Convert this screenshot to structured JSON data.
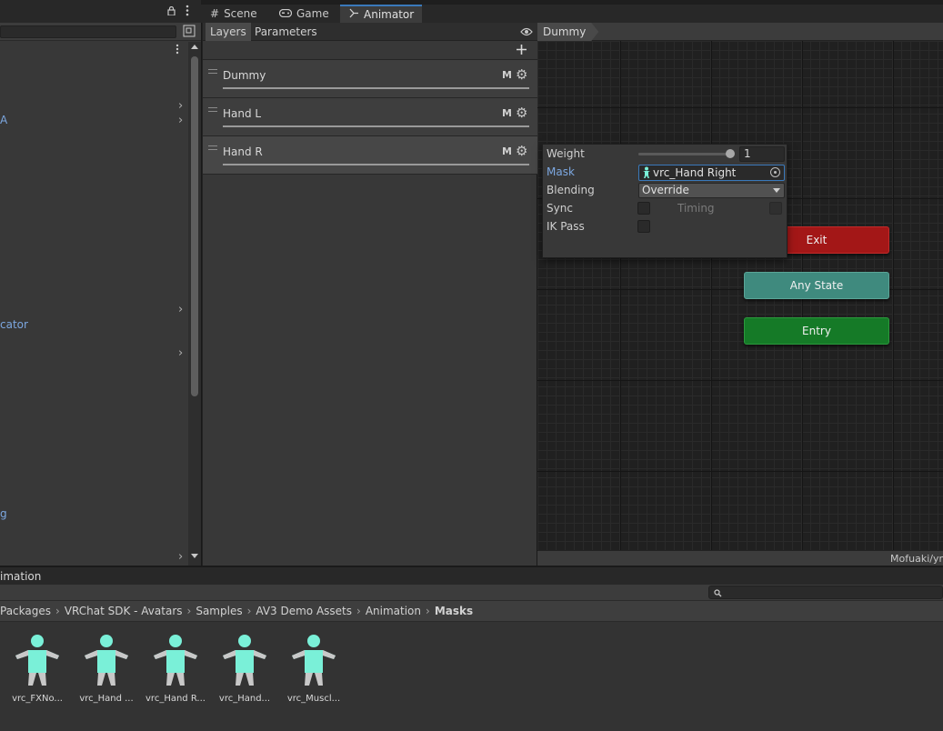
{
  "left_panel": {
    "items": [
      {
        "label": "A"
      },
      {
        "label": "cator"
      },
      {
        "label": "g"
      }
    ]
  },
  "tabs": [
    {
      "label": "Scene",
      "icon": "grid-icon"
    },
    {
      "label": "Game",
      "icon": "gamepad-icon"
    },
    {
      "label": "Animator",
      "icon": "animator-icon"
    }
  ],
  "animator": {
    "sub_tabs": [
      "Layers",
      "Parameters"
    ],
    "layers": [
      {
        "name": "Dummy",
        "mask_flag": "M"
      },
      {
        "name": "Hand L",
        "mask_flag": "M"
      },
      {
        "name": "Hand R",
        "mask_flag": "M"
      }
    ],
    "breadcrumb": "Dummy",
    "footer": "Mofuaki/yr",
    "states": {
      "exit": "Exit",
      "any_state": "Any State",
      "entry": "Entry"
    }
  },
  "layer_settings": {
    "weight_label": "Weight",
    "weight_value": "1",
    "weight_fraction": 1.0,
    "mask_label": "Mask",
    "mask_value": "vrc_Hand Right",
    "blending_label": "Blending",
    "blending_value": "Override",
    "sync_label": "Sync",
    "timing_label": "Timing",
    "ik_pass_label": "IK Pass",
    "sync_checked": false,
    "timing_checked": false,
    "ik_pass_checked": false
  },
  "project": {
    "title": "imation",
    "breadcrumbs": [
      "Packages",
      "VRChat SDK - Avatars",
      "Samples",
      "AV3 Demo Assets",
      "Animation",
      "Masks"
    ],
    "assets": [
      {
        "name": "vrc_FXNo..."
      },
      {
        "name": "vrc_Hand ..."
      },
      {
        "name": "vrc_Hand R..."
      },
      {
        "name": "vrc_Hand..."
      },
      {
        "name": "vrc_Muscl..."
      }
    ]
  },
  "colors": {
    "accent": "#3a79bb",
    "link": "#7ca7e0",
    "exit_state": "#a31717",
    "any_state": "#3f8a7e",
    "entry_state": "#157a27",
    "mask_figure": "#7af0d8"
  }
}
